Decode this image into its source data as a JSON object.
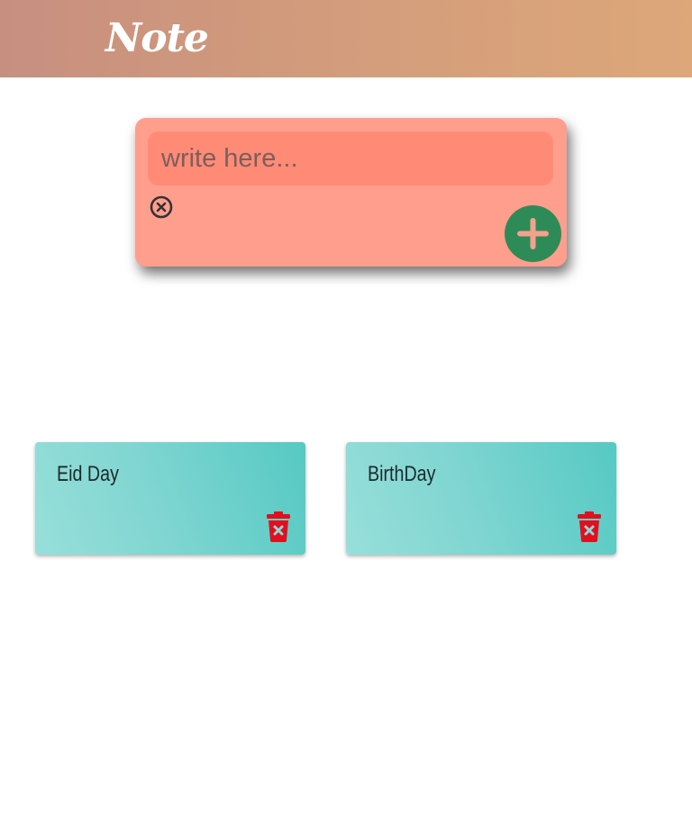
{
  "header": {
    "title": "Note"
  },
  "composer": {
    "input_value": "",
    "input_placeholder": "write here...",
    "clear_icon": "close-circle-icon",
    "add_icon": "plus-icon",
    "add_button_color": "#2e8b57"
  },
  "notes": [
    {
      "text": "Eid Day",
      "delete_icon": "trash-icon"
    },
    {
      "text": "BirthDay",
      "delete_icon": "trash-icon"
    }
  ],
  "colors": {
    "header_start": "#c78f80",
    "header_end": "#dda77a",
    "composer_bg": "#ff9e8d",
    "input_bg": "#ff8b77",
    "note_bg": "#7fd5d1",
    "delete_red": "#e01020"
  }
}
